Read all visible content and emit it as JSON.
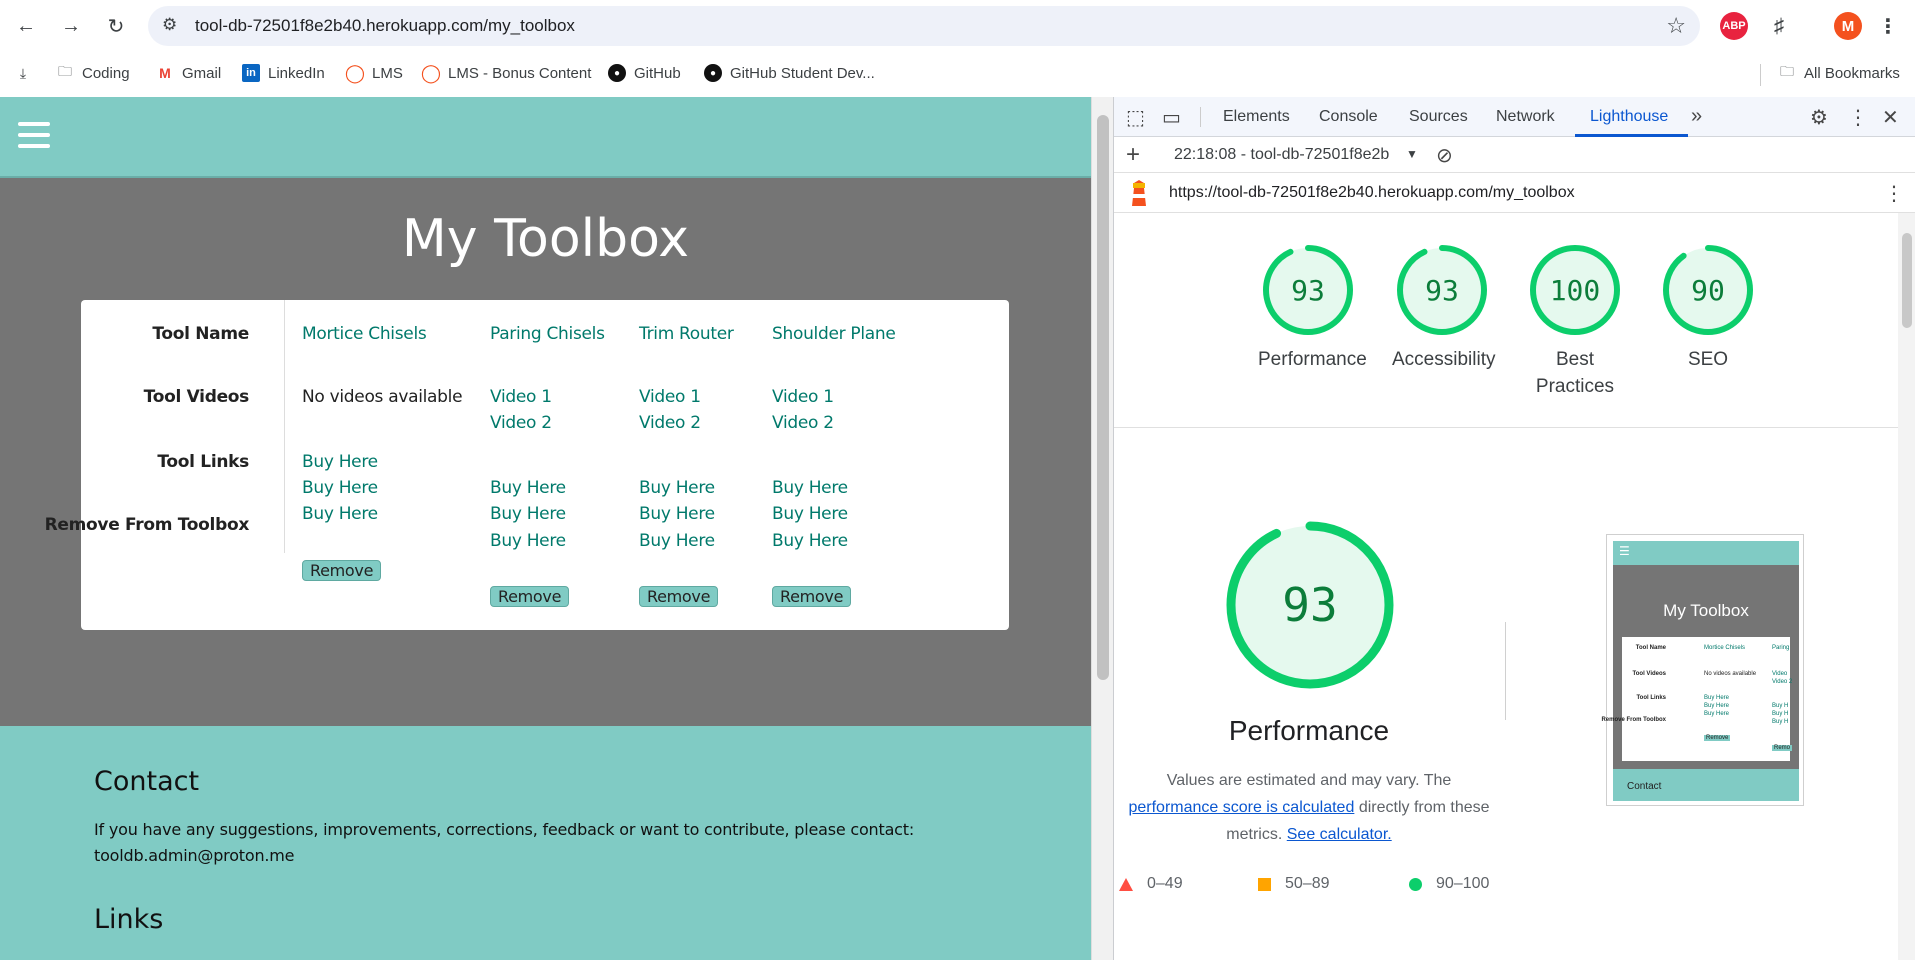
{
  "browser": {
    "url": "tool-db-72501f8e2b40.herokuapp.com/my_toolbox",
    "profile_initial": "M",
    "abp_label": "ABP",
    "bookmarks": [
      "Coding",
      "Gmail",
      "LinkedIn",
      "LMS",
      "LMS - Bonus Content",
      "GitHub",
      "GitHub Student Dev..."
    ],
    "all_bookmarks": "All Bookmarks"
  },
  "page": {
    "title": "My Toolbox",
    "row_headers": {
      "name": "Tool Name",
      "videos": "Tool Videos",
      "links": "Tool Links",
      "remove": "Remove From Toolbox"
    },
    "tools": [
      {
        "name": "Mortice Chisels",
        "videos": [
          "No videos available"
        ],
        "links": [
          "Buy Here",
          "Buy Here",
          "Buy Here"
        ],
        "remove": "Remove"
      },
      {
        "name": "Paring Chisels",
        "videos": [
          "Video 1",
          "Video 2"
        ],
        "links": [
          "Buy Here",
          "Buy Here",
          "Buy Here"
        ],
        "remove": "Remove"
      },
      {
        "name": "Trim Router",
        "videos": [
          "Video 1",
          "Video 2"
        ],
        "links": [
          "Buy Here",
          "Buy Here",
          "Buy Here"
        ],
        "remove": "Remove"
      },
      {
        "name": "Shoulder Plane",
        "videos": [
          "Video 1",
          "Video 2"
        ],
        "links": [
          "Buy Here",
          "Buy Here",
          "Buy Here"
        ],
        "remove": "Remove"
      }
    ],
    "footer": {
      "contact_heading": "Contact",
      "contact_text": "If you have any suggestions, improvements, corrections, feedback or want to contribute, please contact: tooldb.admin@proton.me",
      "links_heading": "Links"
    }
  },
  "devtools": {
    "tabs": [
      "Elements",
      "Console",
      "Sources",
      "Network",
      "Lighthouse"
    ],
    "active_tab": "Lighthouse",
    "report_select": "22:18:08 - tool-db-72501f8e2b",
    "audited_url": "https://tool-db-72501f8e2b40.herokuapp.com/my_toolbox",
    "scores": [
      {
        "label": "Performance",
        "value": 93
      },
      {
        "label": "Accessibility",
        "value": 93
      },
      {
        "label": "Best Practices",
        "value": 100
      },
      {
        "label": "SEO",
        "value": 90
      }
    ],
    "big_score": {
      "label": "Performance",
      "value": 93
    },
    "description": {
      "prefix": "Values are estimated and may vary. The",
      "link1": "performance score is calculated",
      "middle": "directly from these metrics.",
      "link2": "See calculator."
    },
    "legend": [
      "0–49",
      "50–89",
      "90–100"
    ],
    "colors": {
      "pass": "#0cce6b",
      "average": "#ffa400",
      "fail": "#ff4e42",
      "accent": "#0b57d0",
      "site_teal": "#80cbc4"
    },
    "thumbnail": {
      "title": "My Toolbox",
      "rows": [
        "Tool Name",
        "Tool Videos",
        "Tool Links",
        "Remove From Toolbox"
      ],
      "col1": [
        "Mortice Chisels",
        "No videos available",
        "Buy Here",
        "Buy Here",
        "Buy Here"
      ],
      "col2": [
        "Paring",
        "Video",
        "Video 2",
        "Buy H",
        "Buy H",
        "Buy H"
      ],
      "remove": "Remove",
      "remove2": "Remo",
      "footer": "Contact"
    }
  }
}
